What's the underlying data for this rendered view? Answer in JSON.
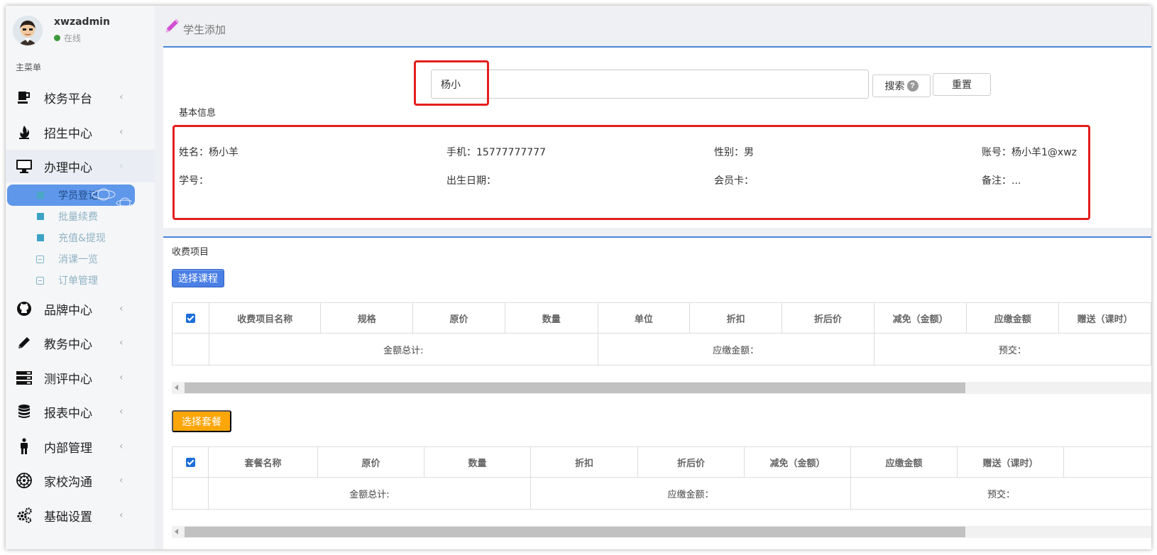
{
  "user": {
    "name": "xwzadmin",
    "status": "在线"
  },
  "sidebar": {
    "menu_title": "主菜单",
    "items": [
      {
        "label": "校务平台",
        "icon": "cup-icon"
      },
      {
        "label": "招生中心",
        "icon": "fire-icon"
      },
      {
        "label": "办理中心",
        "icon": "monitor-icon"
      },
      {
        "label": "品牌中心",
        "icon": "github-icon"
      },
      {
        "label": "教务中心",
        "icon": "pencil-icon"
      },
      {
        "label": "测评中心",
        "icon": "server-icon"
      },
      {
        "label": "报表中心",
        "icon": "database-icon"
      },
      {
        "label": "内部管理",
        "icon": "person-icon"
      },
      {
        "label": "家校沟通",
        "icon": "empire-icon"
      },
      {
        "label": "基础设置",
        "icon": "gears-icon"
      }
    ],
    "subitems": [
      {
        "label": "学员登记"
      },
      {
        "label": "批量续费"
      },
      {
        "label": "充值&提现"
      },
      {
        "label": "消课一览"
      },
      {
        "label": "订单管理"
      }
    ],
    "chevron": "‹"
  },
  "page": {
    "title": "学生添加"
  },
  "search": {
    "value": "杨小",
    "search_label": "搜索",
    "reset_label": "重置",
    "help": "?"
  },
  "basic_info": {
    "title": "基本信息",
    "name": "姓名：杨小羊",
    "phone": "手机：15777777777",
    "gender": "性别：男",
    "account": "账号：杨小羊1@xwz",
    "student_no": "学号：",
    "birthday": "出生日期：",
    "member_card": "会员卡：",
    "remark": "备注：..."
  },
  "fees": {
    "title": "收费项目",
    "select_course": "选择课程",
    "columns": [
      "收费项目名称",
      "规格",
      "原价",
      "数量",
      "单位",
      "折扣",
      "折后价",
      "减免（金额）",
      "应缴金额",
      "赠送（课时）"
    ],
    "total_label": "金额总计:",
    "due_label": "应缴金额：",
    "prepay_label": "预交："
  },
  "package": {
    "select_package": "选择套餐",
    "columns": [
      "套餐名称",
      "原价",
      "数量",
      "折扣",
      "折后价",
      "减免（金额）",
      "应缴金额",
      "赠送（课时）"
    ],
    "total_label": "金额总计:",
    "due_label": "应缴金额：",
    "prepay_label": "预交："
  }
}
